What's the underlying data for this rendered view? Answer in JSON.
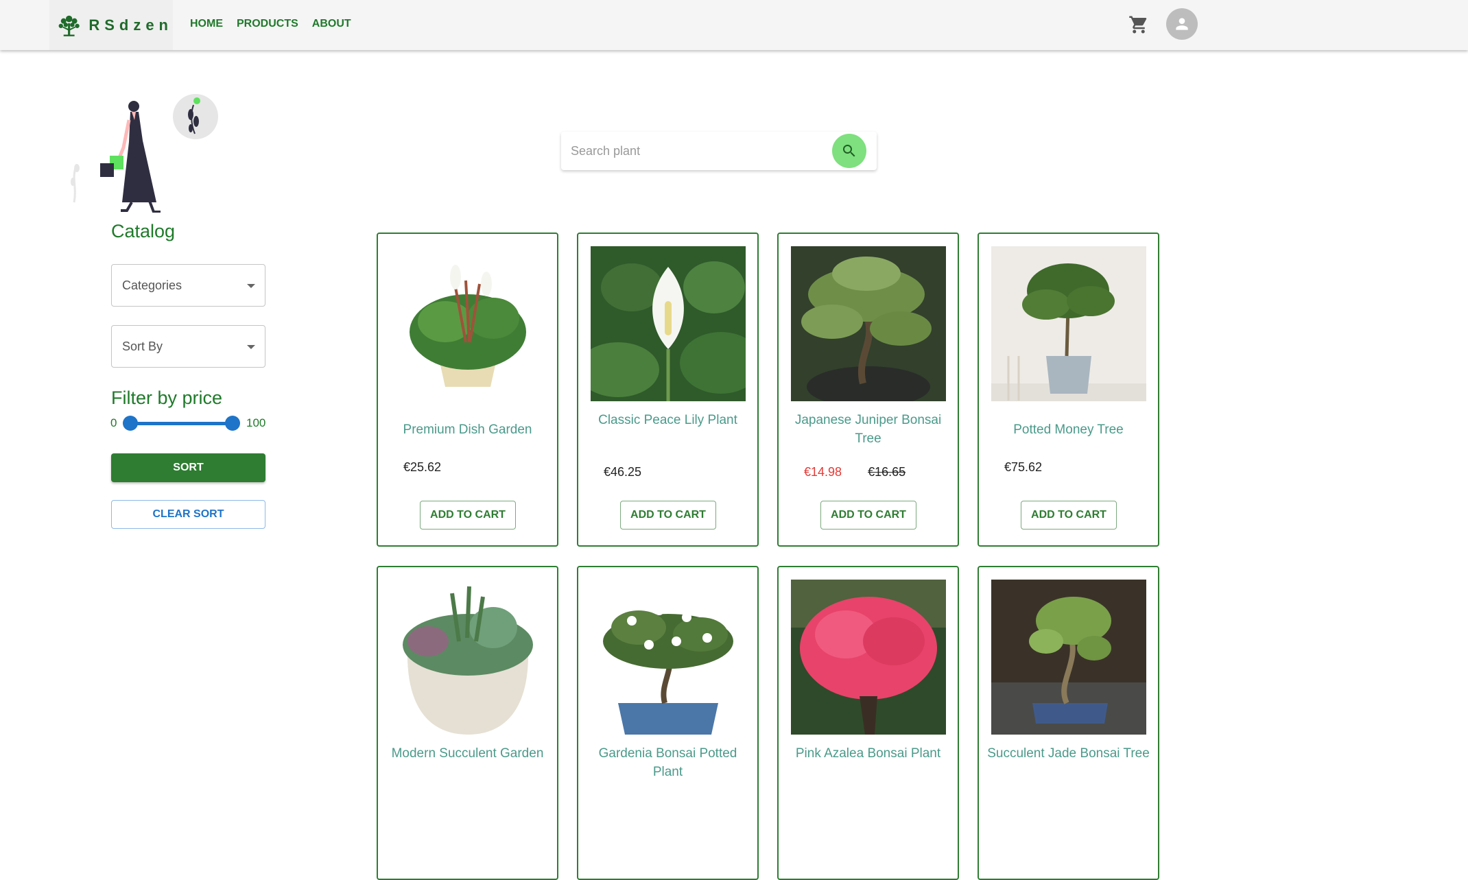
{
  "header": {
    "brand": "RSdzen",
    "nav": [
      {
        "label": "HOME"
      },
      {
        "label": "PRODUCTS"
      },
      {
        "label": "ABOUT"
      }
    ]
  },
  "sidebar": {
    "catalog_title": "Catalog",
    "categories_label": "Categories",
    "sort_by_label": "Sort By",
    "filter_title": "Filter by price",
    "range_min": "0",
    "range_max": "100",
    "slider_value": [
      0,
      100
    ],
    "sort_button": "SORT",
    "clear_button": "CLEAR SORT"
  },
  "search": {
    "placeholder": "Search plant"
  },
  "colors": {
    "brand_green": "#2e7d32",
    "accent_blue": "#1e74c8",
    "sale_red": "#e53935",
    "search_button": "#7ee07e"
  },
  "products": [
    {
      "name": "Premium Dish Garden",
      "price": "€25.62",
      "button": "ADD TO CART"
    },
    {
      "name": "Classic Peace Lily Plant",
      "price": "€46.25",
      "button": "ADD TO CART"
    },
    {
      "name": "Japanese Juniper Bonsai Tree",
      "sale_price": "€14.98",
      "old_price": "€16.65",
      "button": "ADD TO CART"
    },
    {
      "name": "Potted Money Tree",
      "price": "€75.62",
      "button": "ADD TO CART"
    },
    {
      "name": "Modern Succulent Garden"
    },
    {
      "name": "Gardenia Bonsai Potted Plant"
    },
    {
      "name": "Pink Azalea Bonsai Plant"
    },
    {
      "name": "Succulent Jade Bonsai Tree"
    }
  ]
}
